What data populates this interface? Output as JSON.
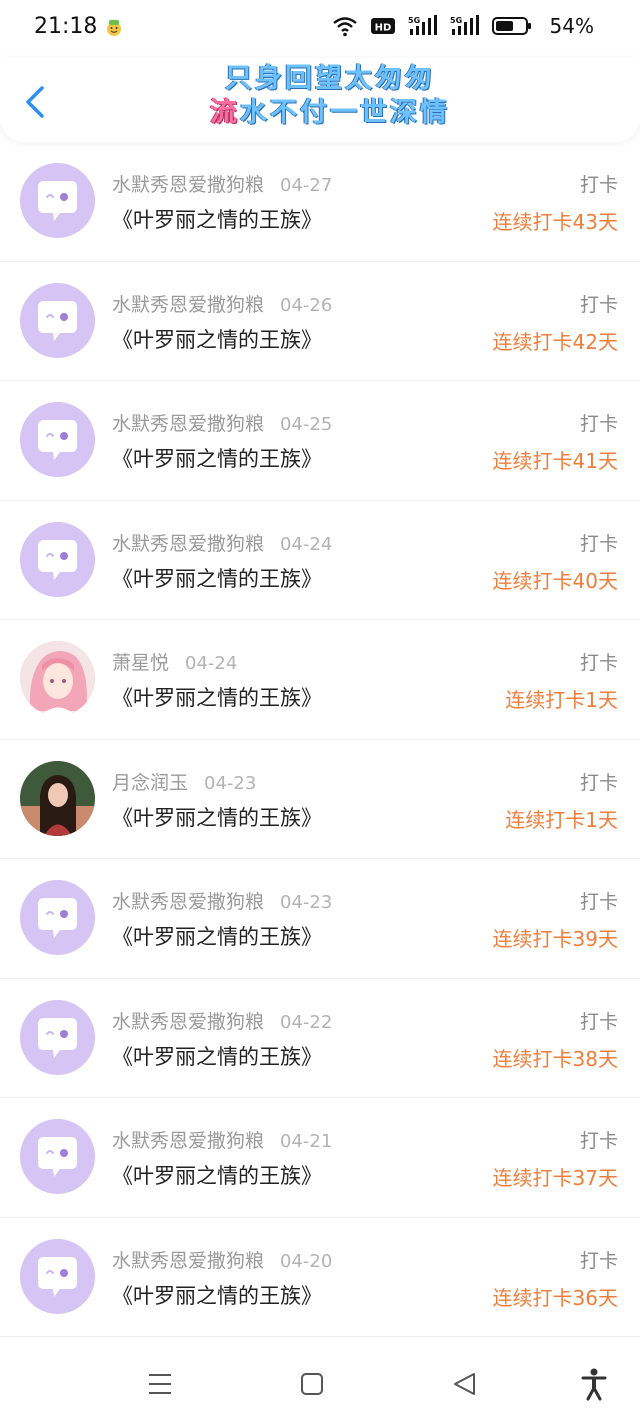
{
  "status_bar": {
    "time": "21:18",
    "battery_percent": "54%",
    "network_badge": "HD",
    "signal_1": "5G",
    "signal_2": "5G"
  },
  "header": {
    "title_line_1": "只身回望太匆匆",
    "title_line_2_accent": "流",
    "title_line_2_rest": "水不付一世深情"
  },
  "records": [
    {
      "name": "水默秀恩爱撒狗粮",
      "date": "04-27",
      "book": "《叶罗丽之情的王族》",
      "tag": "打卡",
      "streak": "连续打卡43天",
      "avatar": "default"
    },
    {
      "name": "水默秀恩爱撒狗粮",
      "date": "04-26",
      "book": "《叶罗丽之情的王族》",
      "tag": "打卡",
      "streak": "连续打卡42天",
      "avatar": "default"
    },
    {
      "name": "水默秀恩爱撒狗粮",
      "date": "04-25",
      "book": "《叶罗丽之情的王族》",
      "tag": "打卡",
      "streak": "连续打卡41天",
      "avatar": "default"
    },
    {
      "name": "水默秀恩爱撒狗粮",
      "date": "04-24",
      "book": "《叶罗丽之情的王族》",
      "tag": "打卡",
      "streak": "连续打卡40天",
      "avatar": "default"
    },
    {
      "name": "萧星悦",
      "date": "04-24",
      "book": "《叶罗丽之情的王族》",
      "tag": "打卡",
      "streak": "连续打卡1天",
      "avatar": "anime-girl"
    },
    {
      "name": "月念润玉",
      "date": "04-23",
      "book": "《叶罗丽之情的王族》",
      "tag": "打卡",
      "streak": "连续打卡1天",
      "avatar": "photo-girl"
    },
    {
      "name": "水默秀恩爱撒狗粮",
      "date": "04-23",
      "book": "《叶罗丽之情的王族》",
      "tag": "打卡",
      "streak": "连续打卡39天",
      "avatar": "default"
    },
    {
      "name": "水默秀恩爱撒狗粮",
      "date": "04-22",
      "book": "《叶罗丽之情的王族》",
      "tag": "打卡",
      "streak": "连续打卡38天",
      "avatar": "default"
    },
    {
      "name": "水默秀恩爱撒狗粮",
      "date": "04-21",
      "book": "《叶罗丽之情的王族》",
      "tag": "打卡",
      "streak": "连续打卡37天",
      "avatar": "default"
    },
    {
      "name": "水默秀恩爱撒狗粮",
      "date": "04-20",
      "book": "《叶罗丽之情的王族》",
      "tag": "打卡",
      "streak": "连续打卡36天",
      "avatar": "default"
    }
  ],
  "icons": {
    "back": "chevron-left-icon",
    "menu": "menu-icon",
    "home": "home-square-icon",
    "back_nav": "triangle-back-icon",
    "accessibility": "accessibility-icon"
  },
  "colors": {
    "accent_blue": "#2f8ff0",
    "streak_orange": "#f07d3a",
    "avatar_purple": "#d6c4f5",
    "title_pink": "#ff6fa2"
  }
}
